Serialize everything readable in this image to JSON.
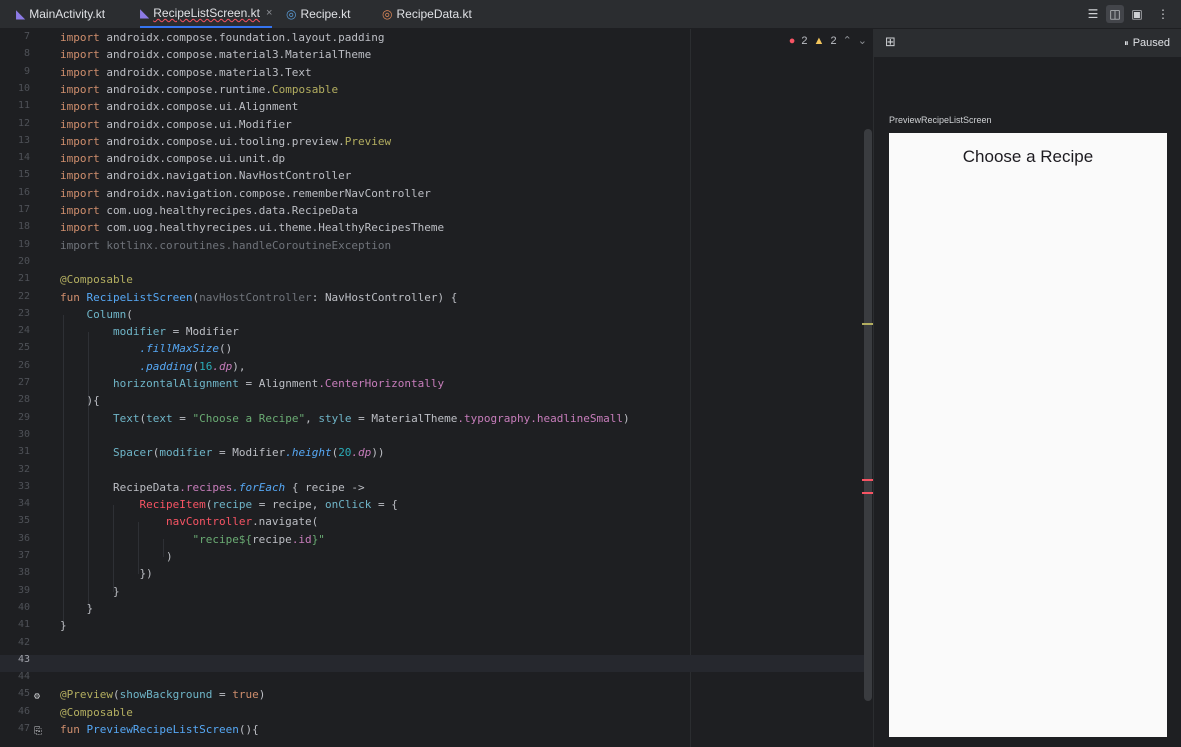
{
  "tabs": [
    {
      "label": "MainActivity.kt",
      "icon": "kotlin-file-icon",
      "active": false
    },
    {
      "label": "RecipeListScreen.kt",
      "icon": "kotlin-file-icon",
      "active": true
    },
    {
      "label": "Recipe.kt",
      "icon": "kotlin-class-icon",
      "active": false
    },
    {
      "label": "RecipeData.kt",
      "icon": "kotlin-object-icon",
      "active": false
    }
  ],
  "close_glyph": "×",
  "inspections": {
    "errors": "2",
    "warnings": "2"
  },
  "preview": {
    "status": "Paused",
    "label": "PreviewRecipeListScreen",
    "screen_title": "Choose a Recipe"
  },
  "code": {
    "line_numbers": [
      "7",
      "8",
      "9",
      "10",
      "11",
      "12",
      "13",
      "14",
      "15",
      "16",
      "17",
      "18",
      "19",
      "20",
      "21",
      "22",
      "23",
      "24",
      "25",
      "26",
      "27",
      "28",
      "29",
      "30",
      "31",
      "32",
      "33",
      "34",
      "35",
      "36",
      "37",
      "38",
      "39",
      "40",
      "41",
      "42",
      "43",
      "44",
      "45",
      "46",
      "47"
    ],
    "current_line": "43",
    "imports": [
      "androidx.compose.foundation.layout.padding",
      "androidx.compose.material3.MaterialTheme",
      "androidx.compose.material3.Text",
      "androidx.compose.runtime.",
      "androidx.compose.ui.Alignment",
      "androidx.compose.ui.Modifier",
      "androidx.compose.ui.tooling.preview.",
      "androidx.compose.ui.unit.dp",
      "androidx.navigation.NavHostController",
      "androidx.navigation.compose.rememberNavController",
      "com.uog.healthyrecipes.data.RecipeData",
      "com.uog.healthyrecipes.ui.theme.HealthyRecipesTheme",
      "kotlinx.coroutines.handleCoroutineException"
    ],
    "import_kw": "import",
    "composable_highlight": "Composable",
    "preview_highlight": "Preview",
    "ann_composable": "@Composable",
    "ann_preview": "@Preview",
    "kw_fun": "fun",
    "fn_list": "RecipeListScreen",
    "param_nav": "navHostController",
    "type_nav": "NavHostController",
    "column": "Column",
    "modifier_param": "modifier",
    "modifier_obj": "Modifier",
    "fill_max": ".fillMaxSize",
    "padding_fn": ".padding",
    "num_16": "16",
    "dp_prop": ".dp",
    "h_align": "horizontalAlignment",
    "alignment_obj": "Alignment",
    "center_h": ".CenterHorizontally",
    "text_fn": "Text",
    "text_param": "text",
    "text_value": "\"Choose a Recipe\"",
    "style_param": "style",
    "material_theme": "MaterialTheme",
    "typography": ".typography",
    "headline_small": ".headlineSmall",
    "spacer_fn": "Spacer",
    "height_fn": ".height",
    "num_20": "20",
    "recipe_data": "RecipeData",
    "recipes_prop": ".recipes",
    "for_each": ".forEach",
    "lambda_recipe": "{ recipe ->",
    "recipe_item": "RecipeItem",
    "recipe_param": "recipe",
    "recipe_arg": "recipe",
    "on_click": "onClick",
    "nav_controller": "navController",
    "navigate": ".navigate(",
    "route_str_start": "\"recipe${",
    "route_recipe": "recipe",
    "route_id": ".id",
    "route_str_end": "}\"",
    "show_background": "showBackground",
    "kw_true": "true",
    "fn_preview": "PreviewRecipeListScreen"
  }
}
